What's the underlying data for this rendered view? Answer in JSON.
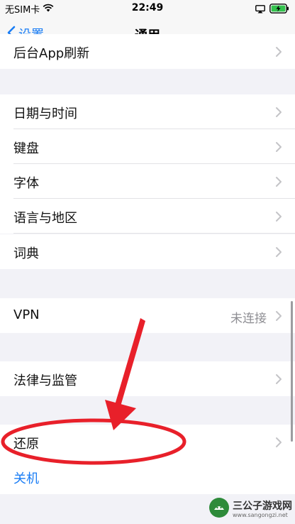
{
  "status_bar": {
    "carrier": "无SIM卡",
    "time": "22:49"
  },
  "nav": {
    "back_label": "设置",
    "title": "通用"
  },
  "rows": [
    {
      "label": "后台App刷新"
    },
    {
      "label": "日期与时间"
    },
    {
      "label": "键盘"
    },
    {
      "label": "字体"
    },
    {
      "label": "语言与地区"
    },
    {
      "label": "词典"
    },
    {
      "label": "VPN",
      "value": "未连接"
    },
    {
      "label": "法律与监管"
    },
    {
      "label": "还原"
    },
    {
      "label": "关机"
    }
  ],
  "watermark": {
    "name": "三公子游戏网",
    "url": "www.sangongzi.net"
  },
  "colors": {
    "accent": "#1a7df5",
    "annotation": "#e8202a"
  },
  "icons": [
    "wifi-icon",
    "airplay-icon",
    "battery-charging-icon",
    "chevron-left-icon",
    "chevron-right-icon"
  ]
}
